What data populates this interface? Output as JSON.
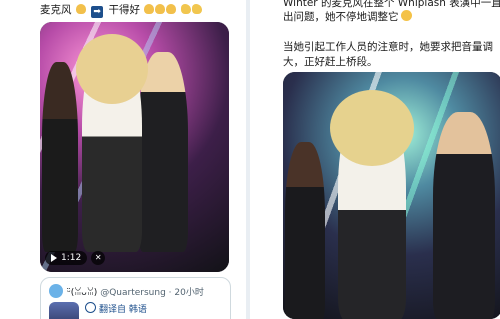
{
  "left_tweet": {
    "text_prefix": "麦克风",
    "text_suffix": "干得好",
    "video": {
      "duration": "1:12"
    },
    "quote": {
      "display_name": "ᵕ̈(ꈍᴗꈍ)",
      "handle": "@Quartersung",
      "time": "20小时",
      "translate_label": "翻译自 韩语"
    }
  },
  "right_post": {
    "line1": "Winter 的麦克风在整个 Whiplash 表演中一直",
    "line2": "出问题，她不停地调整它",
    "line3": "当她引起工作人员的注意时，她要求把音量调",
    "line4": "大，正好赶上桥段。"
  },
  "icons": [
    "right-arrow-emoji",
    "clap-emoji",
    "pointing-hand-emoji",
    "crying-emoji",
    "play-icon",
    "mute-icon",
    "at-icon",
    "translate-icon"
  ],
  "colors": {
    "text": "#1b1b1b",
    "link": "#1d4f8c",
    "muted": "#536471",
    "background": "#e9eef3"
  }
}
